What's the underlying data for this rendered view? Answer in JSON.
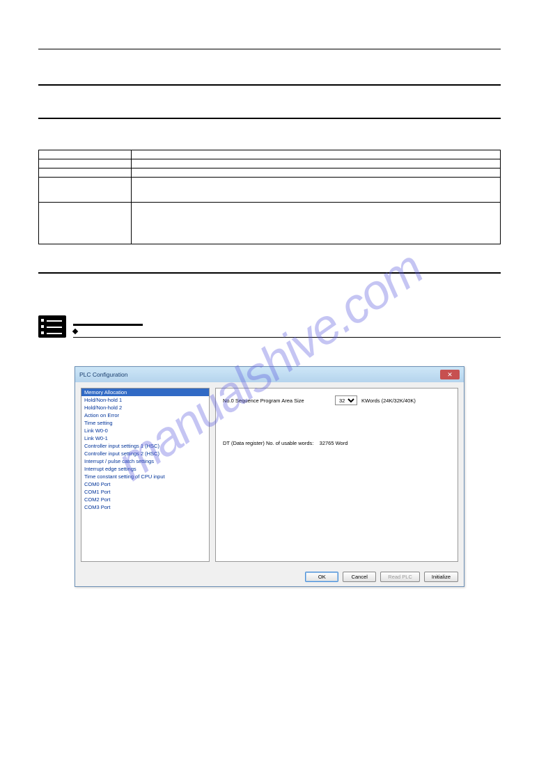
{
  "watermark": "manualshive.com",
  "spec_rows": [
    [
      "",
      ""
    ],
    [
      "",
      ""
    ],
    [
      "",
      ""
    ],
    [
      "",
      ""
    ],
    [
      "",
      ""
    ]
  ],
  "dialog": {
    "title": "PLC Configuration",
    "left_items": [
      "Memory Allocation",
      "Hold/Non-hold 1",
      "Hold/Non-hold 2",
      "Action on Error",
      "Time setting",
      "Link W0-0",
      "Link W0-1",
      "Controller input settings 1 (HSC)",
      "Controller input settings 2 (HSC)",
      "Interrupt / pulse catch settings",
      "Interrupt edge settings",
      "Time constant setting of CPU input",
      "COM0 Port",
      "COM1 Port",
      "COM2 Port",
      "COM3 Port"
    ],
    "selected_index": 0,
    "right": {
      "label_no0": "No.0 Sequence Program Area Size",
      "select_value": "32",
      "unit": "KWords  (24K/32K/40K)",
      "dt_label": "DT (Data register) No. of usable words:",
      "dt_value": "32765 Word"
    },
    "buttons": {
      "ok": "OK",
      "cancel": "Cancel",
      "read_plc": "Read PLC",
      "initialize": "Initialize"
    }
  }
}
